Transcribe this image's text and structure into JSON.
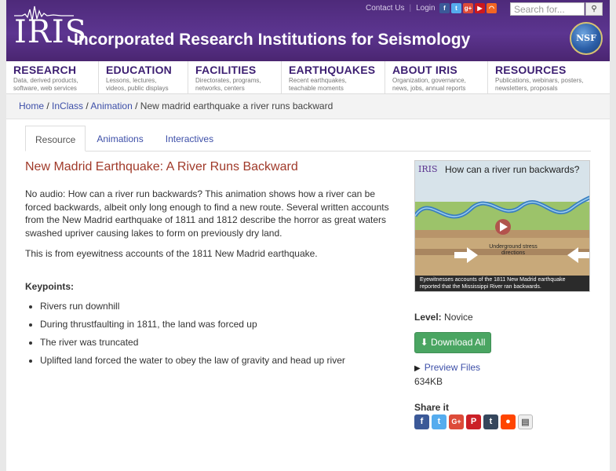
{
  "header": {
    "logo": "IRIS",
    "site_title": "Incorporated Research Institutions for Seismology",
    "top_links": [
      "Contact Us",
      "Login"
    ],
    "search_placeholder": "Search for...",
    "nsf_label": "NSF",
    "social_icons": [
      "facebook-icon",
      "twitter-icon",
      "googleplus-icon",
      "youtube-icon",
      "rss-icon"
    ]
  },
  "nav": [
    {
      "title": "RESEARCH",
      "sub1": "Data, derived products,",
      "sub2": "software, web services"
    },
    {
      "title": "EDUCATION",
      "sub1": "Lessons, lectures,",
      "sub2": "videos, public displays"
    },
    {
      "title": "FACILITIES",
      "sub1": "Directorates, programs,",
      "sub2": "networks, centers"
    },
    {
      "title": "EARTHQUAKES",
      "sub1": "Recent earthquakes,",
      "sub2": "teachable moments"
    },
    {
      "title": "ABOUT IRIS",
      "sub1": "Organization, governance,",
      "sub2": "news, jobs, annual reports"
    },
    {
      "title": "RESOURCES",
      "sub1": "Publications, webinars, posters,",
      "sub2": "newsletters, proposals"
    }
  ],
  "breadcrumb": {
    "items": [
      "Home",
      "InClass",
      "Animation"
    ],
    "current": "New madrid earthquake a river runs backward"
  },
  "tabs": [
    "Resource",
    "Animations",
    "Interactives"
  ],
  "content": {
    "title": "New Madrid Earthquake: A River Runs Backward",
    "description": "No audio: How can a river run backwards? This animation shows how a river can be forced backwards, albeit only long enough to find a new route. Several written accounts from the New Madrid earthquake of 1811 and 1812 describe the horror as great waters swashed upriver causing lakes to form on previously dry land.",
    "description2": "This is from eyewitness accounts of the 1811 New Madrid earthquake.",
    "keypoints_label": "Keypoints:",
    "keypoints": [
      "Rivers run downhill",
      "During thrustfaulting in 1811, the land was forced up",
      "The river was truncated",
      "Uplifted land forced the water to obey the law of gravity and head up river"
    ]
  },
  "sidebar": {
    "thumb_logo": "IRIS",
    "thumb_title": "How can a river run backwards?",
    "thumb_label": "Underground stress directions",
    "thumb_caption1": "Eyewitnesses accounts of the 1811 New Madrid earthquake",
    "thumb_caption2": "reported that the Mississippi River ran backwards.",
    "level_label": "Level:",
    "level_value": "Novice",
    "download_label": "Download All",
    "preview_label": "Preview Files",
    "file_size": "634KB",
    "share_label": "Share it",
    "share_icons": [
      "facebook-icon",
      "twitter-icon",
      "googleplus-icon",
      "pinterest-icon",
      "tumblr-icon",
      "reddit-icon",
      "email-icon"
    ]
  },
  "colors": {
    "header_purple": "#5c3590",
    "nav_text": "#3d1f72",
    "title_red": "#a03a2a",
    "link_blue": "#3d4fa8",
    "download_green": "#4aa562"
  }
}
